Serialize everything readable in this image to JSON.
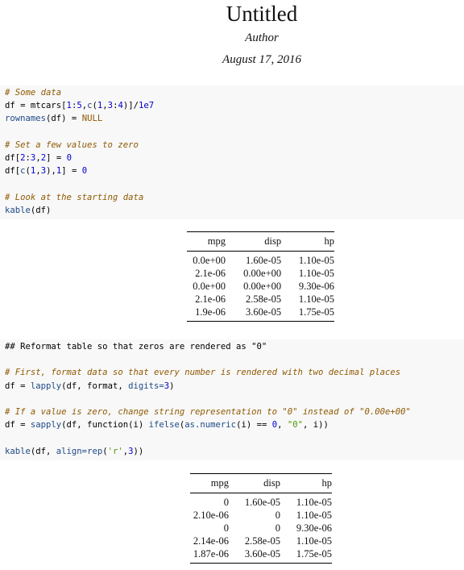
{
  "document": {
    "title": "Untitled",
    "author": "Author",
    "date": "August 17, 2016"
  },
  "code_block_1": {
    "lines": [
      [
        {
          "t": "# Some data",
          "c": "cm"
        }
      ],
      [
        {
          "t": "df = mtcars[",
          "c": ""
        },
        {
          "t": "1",
          "c": "num"
        },
        {
          "t": ":",
          "c": ""
        },
        {
          "t": "5",
          "c": "num"
        },
        {
          "t": ",",
          "c": ""
        },
        {
          "t": "c",
          "c": "fn"
        },
        {
          "t": "(",
          "c": ""
        },
        {
          "t": "1",
          "c": "num"
        },
        {
          "t": ",",
          "c": ""
        },
        {
          "t": "3",
          "c": "num"
        },
        {
          "t": ":",
          "c": ""
        },
        {
          "t": "4",
          "c": "num"
        },
        {
          "t": ")]/",
          "c": ""
        },
        {
          "t": "1e7",
          "c": "num"
        }
      ],
      [
        {
          "t": "rownames",
          "c": "fn"
        },
        {
          "t": "(df) = ",
          "c": ""
        },
        {
          "t": "NULL",
          "c": "kw"
        }
      ],
      [],
      [
        {
          "t": "# Set a few values to zero",
          "c": "cm"
        }
      ],
      [
        {
          "t": "df[",
          "c": ""
        },
        {
          "t": "2",
          "c": "num"
        },
        {
          "t": ":",
          "c": ""
        },
        {
          "t": "3",
          "c": "num"
        },
        {
          "t": ",",
          "c": ""
        },
        {
          "t": "2",
          "c": "num"
        },
        {
          "t": "] = ",
          "c": ""
        },
        {
          "t": "0",
          "c": "num"
        }
      ],
      [
        {
          "t": "df[",
          "c": ""
        },
        {
          "t": "c",
          "c": "fn"
        },
        {
          "t": "(",
          "c": ""
        },
        {
          "t": "1",
          "c": "num"
        },
        {
          "t": ",",
          "c": ""
        },
        {
          "t": "3",
          "c": "num"
        },
        {
          "t": "),",
          "c": ""
        },
        {
          "t": "1",
          "c": "num"
        },
        {
          "t": "] = ",
          "c": ""
        },
        {
          "t": "0",
          "c": "num"
        }
      ],
      [],
      [
        {
          "t": "# Look at the starting data",
          "c": "cm"
        }
      ],
      [
        {
          "t": "kable",
          "c": "fn"
        },
        {
          "t": "(df)",
          "c": ""
        }
      ]
    ]
  },
  "table_1": {
    "headers": [
      "mpg",
      "disp",
      "hp"
    ],
    "rows": [
      [
        "0.0e+00",
        "1.60e-05",
        "1.10e-05"
      ],
      [
        "2.1e-06",
        "0.00e+00",
        "1.10e-05"
      ],
      [
        "0.0e+00",
        "0.00e+00",
        "9.30e-06"
      ],
      [
        "2.1e-06",
        "2.58e-05",
        "1.10e-05"
      ],
      [
        "1.9e-06",
        "3.60e-05",
        "1.75e-05"
      ]
    ]
  },
  "code_block_2": {
    "lines": [
      [
        {
          "t": "## Reformat table so that zeros are rendered as \"0\"",
          "c": ""
        }
      ],
      [],
      [
        {
          "t": "# First, format data so that every number is rendered with two decimal places",
          "c": "cm"
        }
      ],
      [
        {
          "t": "df = ",
          "c": ""
        },
        {
          "t": "lapply",
          "c": "fn"
        },
        {
          "t": "(df, format, ",
          "c": ""
        },
        {
          "t": "digits=",
          "c": "arg"
        },
        {
          "t": "3",
          "c": "num"
        },
        {
          "t": ")",
          "c": ""
        }
      ],
      [],
      [
        {
          "t": "# If a value is zero, change string representation to \"0\" instead of \"0.00e+00\"",
          "c": "cm"
        }
      ],
      [
        {
          "t": "df = ",
          "c": ""
        },
        {
          "t": "sapply",
          "c": "fn"
        },
        {
          "t": "(df, function(i) ",
          "c": ""
        },
        {
          "t": "ifelse",
          "c": "fn"
        },
        {
          "t": "(",
          "c": ""
        },
        {
          "t": "as.numeric",
          "c": "fn"
        },
        {
          "t": "(i) == ",
          "c": ""
        },
        {
          "t": "0",
          "c": "num"
        },
        {
          "t": ", ",
          "c": ""
        },
        {
          "t": "\"0\"",
          "c": "str"
        },
        {
          "t": ", i))",
          "c": ""
        }
      ],
      [],
      [
        {
          "t": "kable",
          "c": "fn"
        },
        {
          "t": "(df, ",
          "c": ""
        },
        {
          "t": "align=",
          "c": "arg"
        },
        {
          "t": "rep",
          "c": "fn"
        },
        {
          "t": "(",
          "c": ""
        },
        {
          "t": "'r'",
          "c": "str"
        },
        {
          "t": ",",
          "c": ""
        },
        {
          "t": "3",
          "c": "num"
        },
        {
          "t": "))",
          "c": ""
        }
      ]
    ]
  },
  "table_2": {
    "headers": [
      "mpg",
      "disp",
      "hp"
    ],
    "rows": [
      [
        "0",
        "1.60e-05",
        "1.10e-05"
      ],
      [
        "2.10e-06",
        "0",
        "1.10e-05"
      ],
      [
        "0",
        "0",
        "9.30e-06"
      ],
      [
        "2.14e-06",
        "2.58e-05",
        "1.10e-05"
      ],
      [
        "1.87e-06",
        "3.60e-05",
        "1.75e-05"
      ]
    ]
  }
}
